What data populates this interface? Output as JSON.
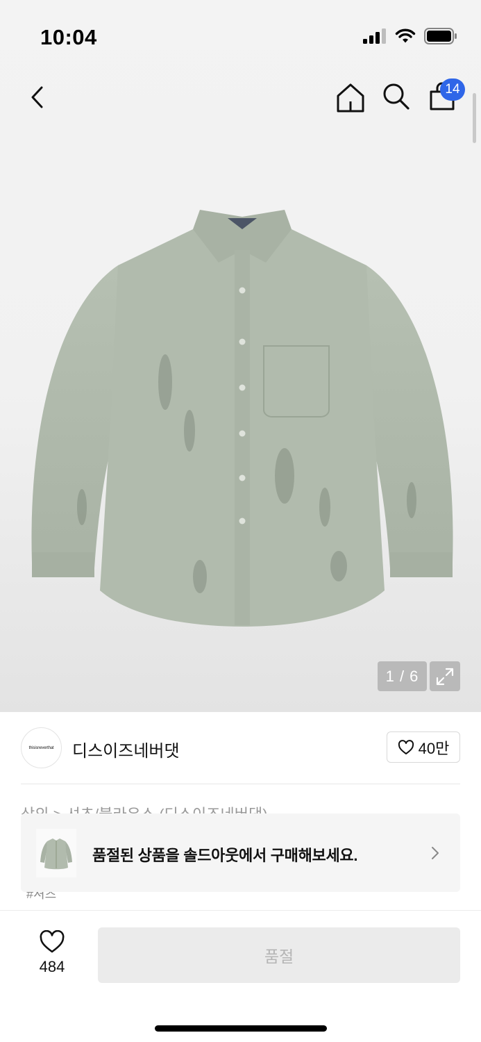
{
  "status_bar": {
    "time": "10:04"
  },
  "header": {
    "icons": [
      "chevron-left-icon",
      "home-icon",
      "search-icon",
      "bag-icon"
    ],
    "cart_badge": "14",
    "badge_color": "#2f66e8"
  },
  "gallery": {
    "counter": "1 / 6",
    "expand_icon": "expand-icon"
  },
  "brand": {
    "logo_text": "thisisneverthat",
    "name": "디스이즈네버댓",
    "follow_count": "40만"
  },
  "breadcrumb_partial": "상의 > 셔츠/블라우스 (디스이즈네버댓)",
  "tag_partial": "#셔츠",
  "soldout_banner": {
    "text": "품절된 상품을 솔드아웃에서 구매해보세요."
  },
  "bottom_bar": {
    "like_count": "484",
    "buy_label": "품절"
  }
}
